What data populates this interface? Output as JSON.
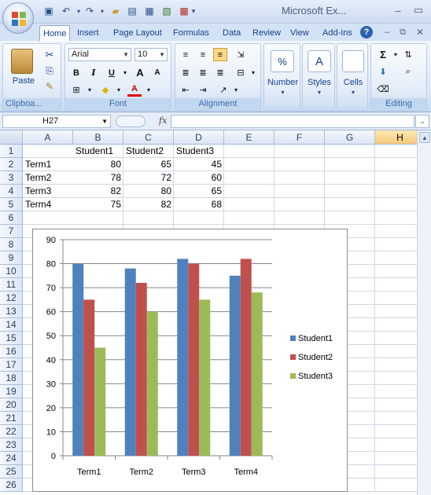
{
  "app": {
    "title": "Microsoft Ex...",
    "tabs": [
      "Home",
      "Insert",
      "Page Layout",
      "Formulas",
      "Data",
      "Review",
      "View",
      "Add-Ins"
    ],
    "active_tab": "Home"
  },
  "ribbon": {
    "clipboard": {
      "label": "Clipboa...",
      "paste": "Paste"
    },
    "font": {
      "label": "Font",
      "name": "Arial",
      "size": "10",
      "bold": "B",
      "italic": "I",
      "underline": "U",
      "grow": "A",
      "shrink": "A",
      "color_letter": "A"
    },
    "alignment": {
      "label": "Alignment"
    },
    "number": {
      "label": "Number",
      "icon_text": "%"
    },
    "styles": {
      "label": "Styles"
    },
    "cells": {
      "label": "Cells"
    },
    "editing": {
      "label": "Editing",
      "sum": "Σ"
    }
  },
  "formula_bar": {
    "name_box": "H27",
    "fx": "fx",
    "value": ""
  },
  "sheet": {
    "columns": [
      "A",
      "B",
      "C",
      "D",
      "E",
      "F",
      "G",
      "H"
    ],
    "selected_column": "H",
    "rows": [
      "1",
      "2",
      "3",
      "4",
      "5",
      "6",
      "7",
      "8",
      "9",
      "10",
      "11",
      "12",
      "13",
      "14",
      "15",
      "16",
      "17",
      "18",
      "19",
      "20",
      "21",
      "22",
      "23",
      "24",
      "25",
      "26"
    ],
    "headers": [
      "Student1",
      "Student2",
      "Student3"
    ],
    "data": [
      {
        "label": "Term1",
        "values": [
          "80",
          "65",
          "45"
        ]
      },
      {
        "label": "Term2",
        "values": [
          "78",
          "72",
          "60"
        ]
      },
      {
        "label": "Term3",
        "values": [
          "82",
          "80",
          "65"
        ]
      },
      {
        "label": "Term4",
        "values": [
          "75",
          "82",
          "68"
        ]
      }
    ]
  },
  "chart_data": {
    "type": "bar",
    "categories": [
      "Term1",
      "Term2",
      "Term3",
      "Term4"
    ],
    "series": [
      {
        "name": "Student1",
        "values": [
          80,
          78,
          82,
          75
        ],
        "color": "#4f81bd"
      },
      {
        "name": "Student2",
        "values": [
          65,
          72,
          80,
          82
        ],
        "color": "#c0504d"
      },
      {
        "name": "Student3",
        "values": [
          45,
          60,
          65,
          68
        ],
        "color": "#9bbb59"
      }
    ],
    "ylim": [
      0,
      90
    ],
    "yticks": [
      "0",
      "10",
      "20",
      "30",
      "40",
      "50",
      "60",
      "70",
      "80",
      "90"
    ],
    "grid": true,
    "legend": "right",
    "title": "",
    "xlabel": "",
    "ylabel": ""
  }
}
